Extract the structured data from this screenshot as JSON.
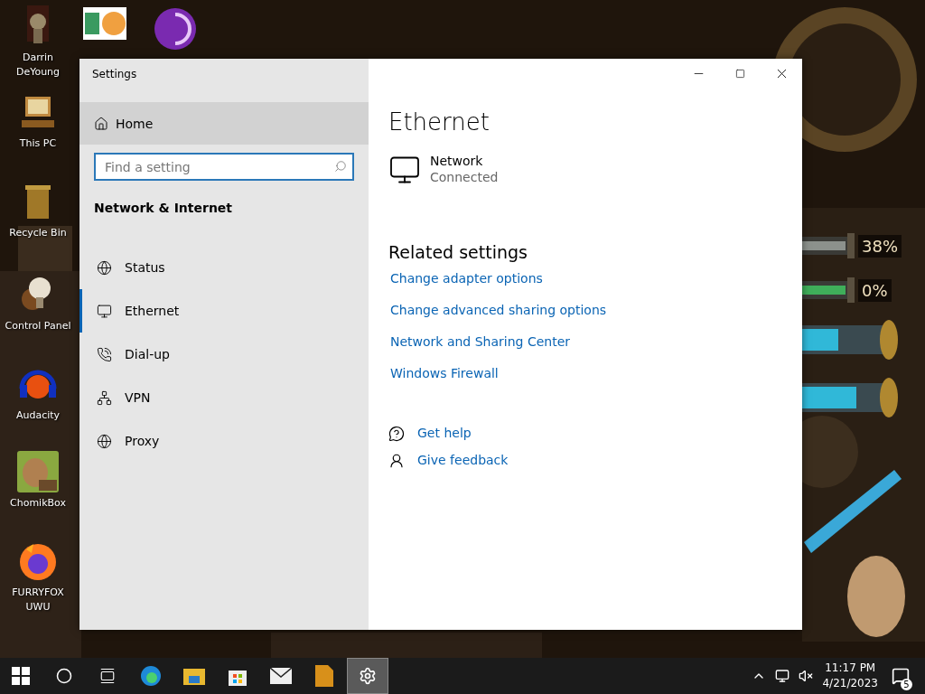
{
  "desktop": {
    "icons": [
      {
        "label": "Darrin DeYoung",
        "kind": "figure"
      },
      {
        "label": "This PC",
        "kind": "computer"
      },
      {
        "label": "Recycle Bin",
        "kind": "bin"
      },
      {
        "label": "Control Panel",
        "kind": "bulb"
      },
      {
        "label": "Audacity",
        "kind": "audio"
      },
      {
        "label": "ChomikBox",
        "kind": "hamster"
      },
      {
        "label": "FURRYFOX UWU",
        "kind": "fox"
      }
    ],
    "top_icons": [
      {
        "kind": "hex"
      },
      {
        "kind": "onion"
      }
    ],
    "meters": [
      {
        "reading": "38%",
        "color": "#8c918c"
      },
      {
        "reading": "0%",
        "color": "#3fae5a"
      }
    ]
  },
  "window": {
    "title": "Settings",
    "sidebar": {
      "home": {
        "label": "Home",
        "hovered": true
      },
      "search": {
        "placeholder": "Find a setting"
      },
      "section": "Network & Internet",
      "items": [
        {
          "label": "Status",
          "kind": "status",
          "selected": false
        },
        {
          "label": "Ethernet",
          "kind": "ethernet",
          "selected": true
        },
        {
          "label": "Dial-up",
          "kind": "dialup",
          "selected": false
        },
        {
          "label": "VPN",
          "kind": "vpn",
          "selected": false
        },
        {
          "label": "Proxy",
          "kind": "proxy",
          "selected": false
        }
      ]
    },
    "main": {
      "heading": "Ethernet",
      "network": {
        "name": "Network",
        "status": "Connected"
      },
      "related": {
        "heading": "Related settings",
        "links": [
          "Change adapter options",
          "Change advanced sharing options",
          "Network and Sharing Center",
          "Windows Firewall"
        ]
      },
      "help": [
        {
          "label": "Get help",
          "kind": "help"
        },
        {
          "label": "Give feedback",
          "kind": "feedback"
        }
      ]
    }
  },
  "taskbar": {
    "apps": [
      {
        "kind": "start",
        "selected": false
      },
      {
        "kind": "search",
        "selected": false
      },
      {
        "kind": "taskview",
        "selected": false
      },
      {
        "kind": "edge",
        "selected": false
      },
      {
        "kind": "folder",
        "selected": false
      },
      {
        "kind": "store",
        "selected": false
      },
      {
        "kind": "mail",
        "selected": false
      },
      {
        "kind": "document",
        "selected": false
      },
      {
        "kind": "settings",
        "selected": true
      }
    ],
    "tray": {
      "time": "11:17 PM",
      "date": "4/21/2023",
      "notifications": "5"
    }
  }
}
